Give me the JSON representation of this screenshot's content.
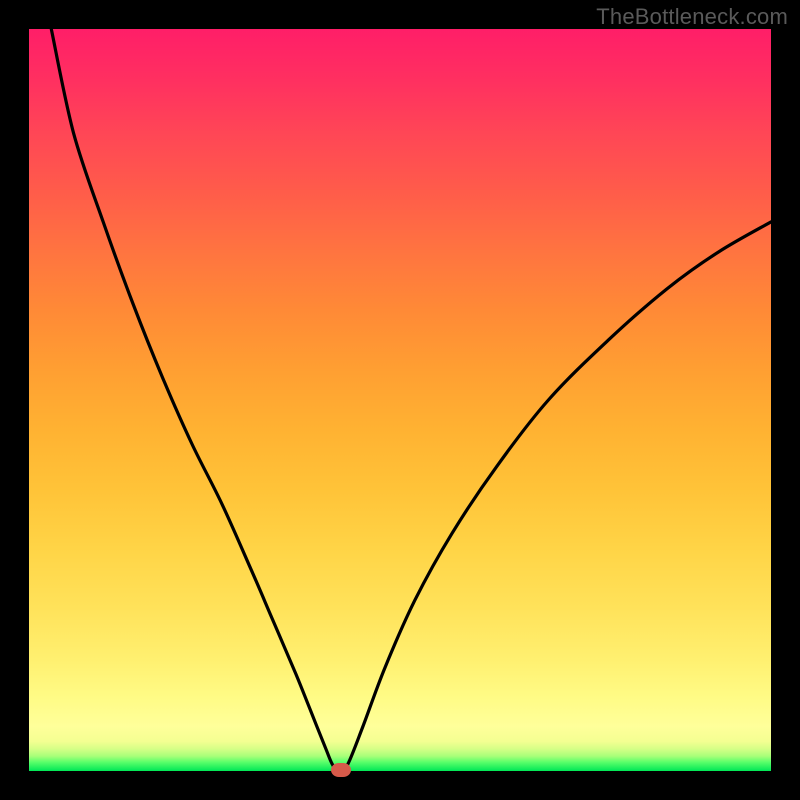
{
  "attribution": "TheBottleneck.com",
  "colors": {
    "frame": "#000000",
    "curve": "#000000",
    "marker": "#d65a4a"
  },
  "chart_data": {
    "type": "line",
    "title": "",
    "xlabel": "",
    "ylabel": "",
    "xlim": [
      0,
      100
    ],
    "ylim": [
      0,
      100
    ],
    "grid": false,
    "legend": false,
    "marker": {
      "x": 42,
      "y": 0
    },
    "notes": "V-shaped bottleneck curve on vertical rainbow (green→red) gradient. Minimum at x≈42, value≈0. Left branch reaches y=100 near x≈3; right branch reaches y≈74 at x=100.",
    "series": [
      {
        "name": "bottleneck-curve",
        "x": [
          3,
          6,
          10,
          14,
          18,
          22,
          26,
          30,
          33,
          36,
          38,
          40,
          41,
          42,
          43,
          45,
          48,
          52,
          57,
          63,
          70,
          78,
          86,
          93,
          100
        ],
        "values": [
          100,
          86,
          74,
          63,
          53,
          44,
          36,
          27,
          20,
          13,
          8,
          3,
          0.7,
          0,
          1,
          6,
          14,
          23,
          32,
          41,
          50,
          58,
          65,
          70,
          74
        ]
      }
    ],
    "background_gradient_stops": [
      {
        "pos": 0.0,
        "color": "#00e756"
      },
      {
        "pos": 0.04,
        "color": "#f4ff92"
      },
      {
        "pos": 0.1,
        "color": "#fffb85"
      },
      {
        "pos": 0.3,
        "color": "#ffd446"
      },
      {
        "pos": 0.6,
        "color": "#ff8a36"
      },
      {
        "pos": 0.85,
        "color": "#ff4656"
      },
      {
        "pos": 1.0,
        "color": "#ff1e68"
      }
    ]
  }
}
